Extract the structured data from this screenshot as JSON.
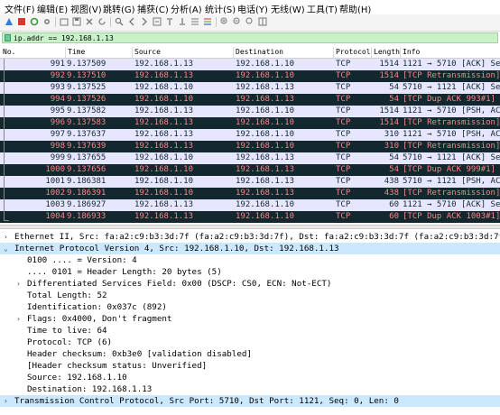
{
  "menu": {
    "file": "文件(F)",
    "edit": "编辑(E)",
    "view": "视图(V)",
    "go": "跳转(G)",
    "capture": "捕获(C)",
    "analyze": "分析(A)",
    "stats": "统计(S)",
    "telephony": "电话(Y)",
    "wireless": "无线(W)",
    "tools": "工具(T)",
    "help": "帮助(H)"
  },
  "filter": {
    "value": "ip.addr == 192.168.1.13"
  },
  "columns": {
    "no": "No.",
    "time": "Time",
    "source": "Source",
    "destination": "Destination",
    "protocol": "Protocol",
    "length": "Length",
    "info": "Info"
  },
  "packets": [
    {
      "no": "991",
      "time": "9.137509",
      "src": "192.168.1.13",
      "dst": "192.168.1.10",
      "proto": "TCP",
      "len": "1514",
      "info": "1121 → 5710 [ACK] Seq",
      "style": "normal"
    },
    {
      "no": "992",
      "time": "9.137510",
      "src": "192.168.1.13",
      "dst": "192.168.1.10",
      "proto": "TCP",
      "len": "1514",
      "info": "[TCP Retransmission]",
      "style": "bad"
    },
    {
      "no": "993",
      "time": "9.137525",
      "src": "192.168.1.10",
      "dst": "192.168.1.13",
      "proto": "TCP",
      "len": "54",
      "info": "5710 → 1121 [ACK] Seq",
      "style": "normal"
    },
    {
      "no": "994",
      "time": "9.137526",
      "src": "192.168.1.10",
      "dst": "192.168.1.13",
      "proto": "TCP",
      "len": "54",
      "info": "[TCP Dup ACK 993#1] 5",
      "style": "bad"
    },
    {
      "no": "995",
      "time": "9.137582",
      "src": "192.168.1.13",
      "dst": "192.168.1.10",
      "proto": "TCP",
      "len": "1514",
      "info": "1121 → 5710 [PSH, ACK",
      "style": "normal"
    },
    {
      "no": "996",
      "time": "9.137583",
      "src": "192.168.1.13",
      "dst": "192.168.1.10",
      "proto": "TCP",
      "len": "1514",
      "info": "[TCP Retransmission]",
      "style": "bad"
    },
    {
      "no": "997",
      "time": "9.137637",
      "src": "192.168.1.13",
      "dst": "192.168.1.10",
      "proto": "TCP",
      "len": "310",
      "info": "1121 → 5710 [PSH, ACK",
      "style": "normal"
    },
    {
      "no": "998",
      "time": "9.137639",
      "src": "192.168.1.13",
      "dst": "192.168.1.10",
      "proto": "TCP",
      "len": "310",
      "info": "[TCP Retransmission]",
      "style": "bad"
    },
    {
      "no": "999",
      "time": "9.137655",
      "src": "192.168.1.10",
      "dst": "192.168.1.13",
      "proto": "TCP",
      "len": "54",
      "info": "5710 → 1121 [ACK] Seq",
      "style": "normal"
    },
    {
      "no": "1000",
      "time": "9.137656",
      "src": "192.168.1.10",
      "dst": "192.168.1.13",
      "proto": "TCP",
      "len": "54",
      "info": "[TCP Dup ACK 999#1] 5",
      "style": "bad"
    },
    {
      "no": "1001",
      "time": "9.186381",
      "src": "192.168.1.10",
      "dst": "192.168.1.13",
      "proto": "TCP",
      "len": "438",
      "info": "5710 → 1121 [PSH, ACK",
      "style": "normal"
    },
    {
      "no": "1002",
      "time": "9.186391",
      "src": "192.168.1.10",
      "dst": "192.168.1.13",
      "proto": "TCP",
      "len": "438",
      "info": "[TCP Retransmission]",
      "style": "bad"
    },
    {
      "no": "1003",
      "time": "9.186927",
      "src": "192.168.1.13",
      "dst": "192.168.1.10",
      "proto": "TCP",
      "len": "60",
      "info": "1121 → 5710 [ACK] Seq",
      "style": "normal"
    },
    {
      "no": "1004",
      "time": "9.186933",
      "src": "192.168.1.13",
      "dst": "192.168.1.10",
      "proto": "TCP",
      "len": "60",
      "info": "[TCP Dup ACK 1003#1]",
      "style": "bad"
    }
  ],
  "details": [
    {
      "text": "Ethernet II, Src: fa:a2:c9:b3:3d:7f (fa:a2:c9:b3:3d:7f), Dst: fa:a2:c9:b3:3d:7f (fa:a2:c9:b3:3d:7f)",
      "indent": 0,
      "arrow": "›",
      "sel": false
    },
    {
      "text": "Internet Protocol Version 4, Src: 192.168.1.10, Dst: 192.168.1.13",
      "indent": 0,
      "arrow": "⌄",
      "sel": true
    },
    {
      "text": "0100 .... = Version: 4",
      "indent": 2,
      "arrow": "",
      "sel": false
    },
    {
      "text": ".... 0101 = Header Length: 20 bytes (5)",
      "indent": 2,
      "arrow": "",
      "sel": false
    },
    {
      "text": "Differentiated Services Field: 0x00 (DSCP: CS0, ECN: Not-ECT)",
      "indent": 1,
      "arrow": "›",
      "sel": false
    },
    {
      "text": "Total Length: 52",
      "indent": 1,
      "arrow": "",
      "sel": false
    },
    {
      "text": "Identification: 0x037c (892)",
      "indent": 1,
      "arrow": "",
      "sel": false
    },
    {
      "text": "Flags: 0x4000, Don't fragment",
      "indent": 1,
      "arrow": "›",
      "sel": false
    },
    {
      "text": "Time to live: 64",
      "indent": 1,
      "arrow": "",
      "sel": false
    },
    {
      "text": "Protocol: TCP (6)",
      "indent": 1,
      "arrow": "",
      "sel": false
    },
    {
      "text": "Header checksum: 0xb3e0 [validation disabled]",
      "indent": 1,
      "arrow": "",
      "sel": false
    },
    {
      "text": "[Header checksum status: Unverified]",
      "indent": 1,
      "arrow": "",
      "sel": false
    },
    {
      "text": "Source: 192.168.1.10",
      "indent": 1,
      "arrow": "",
      "sel": false
    },
    {
      "text": "Destination: 192.168.1.13",
      "indent": 1,
      "arrow": "",
      "sel": false
    },
    {
      "text": "Transmission Control Protocol, Src Port: 5710, Dst Port: 1121, Seq: 0, Len: 0",
      "indent": 0,
      "arrow": "›",
      "sel": true
    }
  ],
  "colors": {
    "normal_bg": "#e7e6ff",
    "normal_fg": "#12272e",
    "bad_bg": "#12272e",
    "bad_fg": "#f78787",
    "selected_bg": "#cce8ff",
    "filter_bg": "#c9f2c9"
  }
}
